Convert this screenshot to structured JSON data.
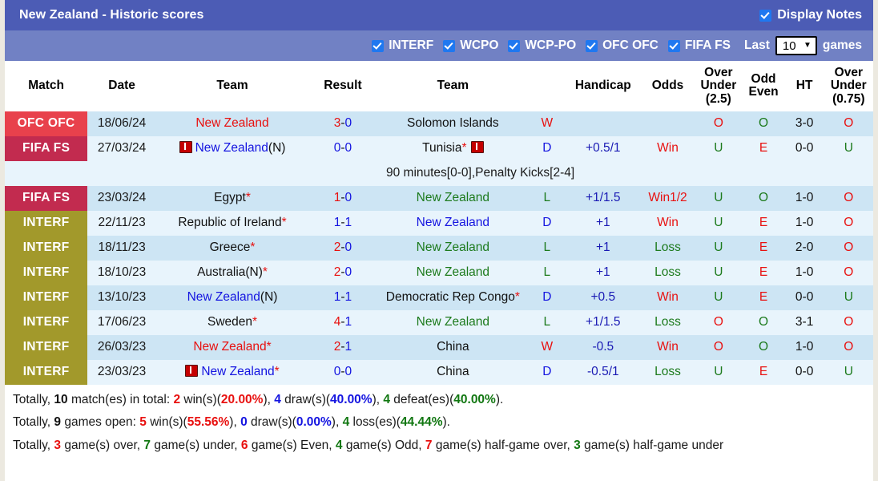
{
  "header": {
    "title": "New Zealand - Historic scores",
    "display_notes_label": "Display Notes",
    "display_notes_checked": true
  },
  "filters": {
    "items": [
      {
        "label": "INTERF",
        "checked": true
      },
      {
        "label": "WCPO",
        "checked": true
      },
      {
        "label": "WCP-PO",
        "checked": true
      },
      {
        "label": "OFC OFC",
        "checked": true
      },
      {
        "label": "FIFA FS",
        "checked": true
      }
    ],
    "last_label": "Last",
    "last_value": "10",
    "games_label": "games"
  },
  "table": {
    "columns": [
      "Match",
      "Date",
      "Team",
      "Result",
      "Team",
      "",
      "Handicap",
      "Odds",
      "Over Under (2.5)",
      "Odd Even",
      "HT",
      "Over Under (0.75)"
    ],
    "columns_multiline": {
      "over_under_25": [
        "Over",
        "Under",
        "(2.5)"
      ],
      "odd_even": [
        "Odd",
        "Even"
      ],
      "over_under_075": [
        "Over",
        "Under",
        "(0.75)"
      ]
    },
    "rows": [
      {
        "match": "OFC OFC",
        "match_style": "ofc",
        "date": "18/06/24",
        "team_home": "New Zealand",
        "team_home_color": "red",
        "team_home_flag": false,
        "team_home_suffix": "",
        "team_home_star": false,
        "result_left": "3",
        "result_left_color": "red",
        "result_right": "0",
        "result_right_color": "blue",
        "team_away": "Solomon Islands",
        "team_away_color": "black",
        "team_away_flag": false,
        "team_away_suffix": "",
        "team_away_star": false,
        "wdl": "W",
        "wdl_color": "red",
        "handicap": "",
        "handicap_color": "navy",
        "odds": "",
        "odds_color": "red",
        "ou25": "O",
        "ou25_color": "red",
        "oddeven": "O",
        "oddeven_color": "green",
        "ht": "3-0",
        "ou075": "O",
        "ou075_color": "red"
      },
      {
        "match": "FIFA FS",
        "match_style": "fifa",
        "date": "27/03/24",
        "team_home": "New Zealand",
        "team_home_color": "blue",
        "team_home_flag": true,
        "team_home_suffix": "(N)",
        "team_home_star": false,
        "result_left": "0",
        "result_left_color": "blue",
        "result_right": "0",
        "result_right_color": "blue",
        "team_away": "Tunisia",
        "team_away_color": "black",
        "team_away_flag_after": true,
        "team_away_suffix": "",
        "team_away_star": true,
        "wdl": "D",
        "wdl_color": "blue",
        "handicap": "+0.5/1",
        "handicap_color": "navy",
        "odds": "Win",
        "odds_color": "red",
        "ou25": "U",
        "ou25_color": "green",
        "oddeven": "E",
        "oddeven_color": "red",
        "ht": "0-0",
        "ou075": "U",
        "ou075_color": "green"
      },
      {
        "note": "90 minutes[0-0],Penalty Kicks[2-4]"
      },
      {
        "match": "FIFA FS",
        "match_style": "fifa",
        "date": "23/03/24",
        "team_home": "Egypt",
        "team_home_color": "black",
        "team_home_flag": false,
        "team_home_suffix": "",
        "team_home_star": true,
        "result_left": "1",
        "result_left_color": "red",
        "result_right": "0",
        "result_right_color": "blue",
        "team_away": "New Zealand",
        "team_away_color": "green",
        "team_away_flag": false,
        "team_away_suffix": "",
        "team_away_star": false,
        "wdl": "L",
        "wdl_color": "green",
        "handicap": "+1/1.5",
        "handicap_color": "navy",
        "odds": "Win1/2",
        "odds_color": "red",
        "ou25": "U",
        "ou25_color": "green",
        "oddeven": "O",
        "oddeven_color": "green",
        "ht": "1-0",
        "ou075": "O",
        "ou075_color": "red"
      },
      {
        "match": "INTERF",
        "match_style": "interf",
        "date": "22/11/23",
        "team_home": "Republic of Ireland",
        "team_home_color": "black",
        "team_home_flag": false,
        "team_home_suffix": "",
        "team_home_star": true,
        "result_left": "1",
        "result_left_color": "blue",
        "result_right": "1",
        "result_right_color": "blue",
        "team_away": "New Zealand",
        "team_away_color": "blue",
        "team_away_flag": false,
        "team_away_suffix": "",
        "team_away_star": false,
        "wdl": "D",
        "wdl_color": "blue",
        "handicap": "+1",
        "handicap_color": "navy",
        "odds": "Win",
        "odds_color": "red",
        "ou25": "U",
        "ou25_color": "green",
        "oddeven": "E",
        "oddeven_color": "red",
        "ht": "1-0",
        "ou075": "O",
        "ou075_color": "red"
      },
      {
        "match": "INTERF",
        "match_style": "interf",
        "date": "18/11/23",
        "team_home": "Greece",
        "team_home_color": "black",
        "team_home_flag": false,
        "team_home_suffix": "",
        "team_home_star": true,
        "result_left": "2",
        "result_left_color": "red",
        "result_right": "0",
        "result_right_color": "blue",
        "team_away": "New Zealand",
        "team_away_color": "green",
        "team_away_flag": false,
        "team_away_suffix": "",
        "team_away_star": false,
        "wdl": "L",
        "wdl_color": "green",
        "handicap": "+1",
        "handicap_color": "navy",
        "odds": "Loss",
        "odds_color": "green",
        "ou25": "U",
        "ou25_color": "green",
        "oddeven": "E",
        "oddeven_color": "red",
        "ht": "2-0",
        "ou075": "O",
        "ou075_color": "red"
      },
      {
        "match": "INTERF",
        "match_style": "interf",
        "date": "18/10/23",
        "team_home": "Australia(N)",
        "team_home_color": "black",
        "team_home_flag": false,
        "team_home_suffix": "",
        "team_home_star": true,
        "result_left": "2",
        "result_left_color": "red",
        "result_right": "0",
        "result_right_color": "blue",
        "team_away": "New Zealand",
        "team_away_color": "green",
        "team_away_flag": false,
        "team_away_suffix": "",
        "team_away_star": false,
        "wdl": "L",
        "wdl_color": "green",
        "handicap": "+1",
        "handicap_color": "navy",
        "odds": "Loss",
        "odds_color": "green",
        "ou25": "U",
        "ou25_color": "green",
        "oddeven": "E",
        "oddeven_color": "red",
        "ht": "1-0",
        "ou075": "O",
        "ou075_color": "red"
      },
      {
        "match": "INTERF",
        "match_style": "interf",
        "date": "13/10/23",
        "team_home": "New Zealand",
        "team_home_color": "blue",
        "team_home_flag": false,
        "team_home_suffix": "(N)",
        "team_home_star": false,
        "result_left": "1",
        "result_left_color": "blue",
        "result_right": "1",
        "result_right_color": "blue",
        "team_away": "Democratic Rep Congo",
        "team_away_color": "black",
        "team_away_flag": false,
        "team_away_suffix": "",
        "team_away_star": true,
        "wdl": "D",
        "wdl_color": "blue",
        "handicap": "+0.5",
        "handicap_color": "navy",
        "odds": "Win",
        "odds_color": "red",
        "ou25": "U",
        "ou25_color": "green",
        "oddeven": "E",
        "oddeven_color": "red",
        "ht": "0-0",
        "ou075": "U",
        "ou075_color": "green"
      },
      {
        "match": "INTERF",
        "match_style": "interf",
        "date": "17/06/23",
        "team_home": "Sweden",
        "team_home_color": "black",
        "team_home_flag": false,
        "team_home_suffix": "",
        "team_home_star": true,
        "result_left": "4",
        "result_left_color": "red",
        "result_right": "1",
        "result_right_color": "blue",
        "team_away": "New Zealand",
        "team_away_color": "green",
        "team_away_flag": false,
        "team_away_suffix": "",
        "team_away_star": false,
        "wdl": "L",
        "wdl_color": "green",
        "handicap": "+1/1.5",
        "handicap_color": "navy",
        "odds": "Loss",
        "odds_color": "green",
        "ou25": "O",
        "ou25_color": "red",
        "oddeven": "O",
        "oddeven_color": "green",
        "ht": "3-1",
        "ou075": "O",
        "ou075_color": "red"
      },
      {
        "match": "INTERF",
        "match_style": "interf",
        "date": "26/03/23",
        "team_home": "New Zealand",
        "team_home_color": "red",
        "team_home_flag": false,
        "team_home_suffix": "",
        "team_home_star": true,
        "result_left": "2",
        "result_left_color": "red",
        "result_right": "1",
        "result_right_color": "blue",
        "team_away": "China",
        "team_away_color": "black",
        "team_away_flag": false,
        "team_away_suffix": "",
        "team_away_star": false,
        "wdl": "W",
        "wdl_color": "red",
        "handicap": "-0.5",
        "handicap_color": "navy",
        "odds": "Win",
        "odds_color": "red",
        "ou25": "O",
        "ou25_color": "red",
        "oddeven": "O",
        "oddeven_color": "green",
        "ht": "1-0",
        "ou075": "O",
        "ou075_color": "red"
      },
      {
        "match": "INTERF",
        "match_style": "interf",
        "date": "23/03/23",
        "team_home": "New Zealand",
        "team_home_color": "blue",
        "team_home_flag": true,
        "team_home_suffix": "",
        "team_home_star": true,
        "result_left": "0",
        "result_left_color": "blue",
        "result_right": "0",
        "result_right_color": "blue",
        "team_away": "China",
        "team_away_color": "black",
        "team_away_flag": false,
        "team_away_suffix": "",
        "team_away_star": false,
        "wdl": "D",
        "wdl_color": "blue",
        "handicap": "-0.5/1",
        "handicap_color": "navy",
        "odds": "Loss",
        "odds_color": "green",
        "ou25": "U",
        "ou25_color": "green",
        "oddeven": "E",
        "oddeven_color": "red",
        "ht": "0-0",
        "ou075": "U",
        "ou075_color": "green"
      }
    ]
  },
  "summary": {
    "line1": {
      "prefix": "Totally, ",
      "total": "10",
      "mid1": " match(es) in total: ",
      "wins": "2",
      "mid2": " win(s)(",
      "wins_pct": "20.00%",
      "mid3": "), ",
      "draws": "4",
      "mid4": " draw(s)(",
      "draws_pct": "40.00%",
      "mid5": "), ",
      "defeats": "4",
      "mid6": " defeat(es)(",
      "defeats_pct": "40.00%",
      "suffix": ")."
    },
    "line2": {
      "prefix": "Totally, ",
      "total": "9",
      "mid1": " games open: ",
      "wins": "5",
      "mid2": " win(s)(",
      "wins_pct": "55.56%",
      "mid3": "), ",
      "draws": "0",
      "mid4": " draw(s)(",
      "draws_pct": "0.00%",
      "mid5": "), ",
      "losses": "4",
      "mid6": " loss(es)(",
      "losses_pct": "44.44%",
      "suffix": ")."
    },
    "line3": {
      "prefix": "Totally, ",
      "over": "3",
      "mid1": " game(s) over, ",
      "under": "7",
      "mid2": " game(s) under, ",
      "even": "6",
      "mid3": " game(s) Even, ",
      "odd": "4",
      "mid4": " game(s) Odd, ",
      "half_over": "7",
      "mid5": " game(s) half-game over, ",
      "half_under": "3",
      "suffix": " game(s) half-game under"
    }
  },
  "colors": {
    "titlebar": "#4c5cb5",
    "filterbar": "#7181c4",
    "row_odd": "#cde5f4",
    "row_even": "#e8f4fc",
    "badge_ofc": "#e8414c",
    "badge_fifa": "#c22b4f",
    "badge_interf": "#a2992b",
    "accent_red": "#e8100f",
    "accent_blue": "#1414e0",
    "accent_green": "#1c7a1c"
  }
}
